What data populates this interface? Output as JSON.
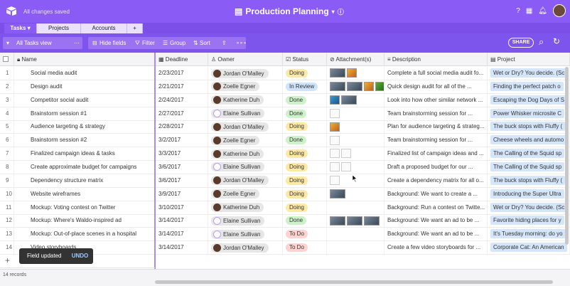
{
  "topbar": {
    "saved_text": "All changes saved",
    "base_title": "Production Planning",
    "icons": [
      "help-icon",
      "apps-icon",
      "bell-icon",
      "avatar"
    ]
  },
  "tabs": [
    {
      "label": "Tasks ▾",
      "active": true
    },
    {
      "label": "Projects",
      "active": false
    },
    {
      "label": "Accounts",
      "active": false
    },
    {
      "label": "+",
      "active": false
    }
  ],
  "toolbar": {
    "view_name": "All Tasks view",
    "hide_fields": "Hide fields",
    "filter": "Filter",
    "group": "Group",
    "sort": "Sort",
    "share": "SHARE"
  },
  "columns": [
    "Name",
    "Deadline",
    "Owner",
    "Status",
    "Attachment(s)",
    "Description",
    "Project"
  ],
  "rows": [
    {
      "num": "1",
      "name": "Social media audit",
      "deadline": "2/23/2017",
      "owner": "Jordan O'Malley",
      "av": "dark",
      "status": "Doing",
      "att": [
        "img",
        "img2"
      ],
      "desc": "Complete a full social media audit fo...",
      "proj": "Wet or Dry? You decide. (Sc"
    },
    {
      "num": "2",
      "name": "Design audit",
      "deadline": "2/21/2017",
      "owner": "Zoelle Egner",
      "av": "dark",
      "status": "In Review",
      "att": [
        "img",
        "img",
        "img2",
        "img4"
      ],
      "desc": "Quick design audit for all of the ...",
      "proj": "Finding the perfect patch o"
    },
    {
      "num": "3",
      "name": "Competitor social audit",
      "deadline": "2/24/2017",
      "owner": "Katherine Duh",
      "av": "dark",
      "status": "Done",
      "att": [
        "img3",
        "img"
      ],
      "desc": "Look into how other similar network ...",
      "proj": "Escaping the Dog Days of S"
    },
    {
      "num": "4",
      "name": "Brainstorm session #1",
      "deadline": "2/27/2017",
      "owner": "Elaine Sullivan",
      "av": "outline",
      "status": "Done",
      "att": [
        "doc"
      ],
      "desc": "Team brainstorming session for ...",
      "proj": "Power Whisker microsite  C"
    },
    {
      "num": "5",
      "name": "Audience targeting & strategy",
      "deadline": "2/28/2017",
      "owner": "Jordan O'Malley",
      "av": "dark",
      "status": "Doing",
      "att": [
        "img2"
      ],
      "desc": "Plan for audience targeting & strateg...",
      "proj": "The buck stops with Fluffy ("
    },
    {
      "num": "6",
      "name": "Brainstorm session #2",
      "deadline": "3/2/2017",
      "owner": "Zoelle Egner",
      "av": "dark",
      "status": "Done",
      "att": [
        "doc"
      ],
      "desc": "Team brainstorming session for ...",
      "proj": "Cheese wheels and automo"
    },
    {
      "num": "7",
      "name": "Finalized campaign ideas & tasks",
      "deadline": "3/3/2017",
      "owner": "Katherine Duh",
      "av": "dark",
      "status": "Doing",
      "att": [
        "doc",
        "doc"
      ],
      "desc": "Finalized list of campaign ideas and ...",
      "proj": "The Calling of the Squid sp"
    },
    {
      "num": "8",
      "name": "Create approximate budget for campaigns",
      "deadline": "3/6/2017",
      "owner": "Elaine Sullivan",
      "av": "outline",
      "status": "Doing",
      "att": [
        "doc",
        "doc"
      ],
      "desc": "Draft a proposed budget for our ...",
      "proj": "The Calling of the Squid sp"
    },
    {
      "num": "9",
      "name": "Dependency structure matrix",
      "deadline": "3/6/2017",
      "owner": "Jordan O'Malley",
      "av": "dark",
      "status": "Doing",
      "att": [
        "doc"
      ],
      "desc": "Create a dependency matrix for all o...",
      "proj": "The buck stops with Fluffy ("
    },
    {
      "num": "10",
      "name": "Website wireframes",
      "deadline": "3/9/2017",
      "owner": "Zoelle Egner",
      "av": "dark",
      "status": "Doing",
      "att": [
        "img"
      ],
      "desc": "Background: We want to create a ...",
      "proj": "Introducing the Super Ultra"
    },
    {
      "num": "11",
      "name": "Mockup: Voting contest on Twitter",
      "deadline": "3/10/2017",
      "owner": "Katherine Duh",
      "av": "dark",
      "status": "Doing",
      "att": [],
      "desc": "Background: Run a contest on Twitte...",
      "proj": "Wet or Dry? You decide. (Sc"
    },
    {
      "num": "12",
      "name": "Mockup: Where's Waldo-inspired ad",
      "deadline": "3/14/2017",
      "owner": "Elaine Sullivan",
      "av": "outline",
      "status": "Done",
      "att": [
        "img",
        "img",
        "img"
      ],
      "desc": "Background: We want an ad to be ...",
      "proj": "Favorite hiding places for y"
    },
    {
      "num": "13",
      "name": "Mockup: Out-of-place scenes in a hospital",
      "deadline": "3/14/2017",
      "owner": "Elaine Sullivan",
      "av": "outline",
      "status": "To Do",
      "att": [],
      "desc": "Background: We want an ad to be ...",
      "proj": "It's Tuesday morning: do yo"
    },
    {
      "num": "14",
      "name": "Video storyboards",
      "deadline": "3/14/2017",
      "owner": "Jordan O'Malley",
      "av": "dark",
      "status": "To Do",
      "att": [],
      "desc": "Create a few video storyboards for ...",
      "proj": "Corporate Cat: An American"
    }
  ],
  "status_colors": {
    "Doing": "#fde9a6",
    "In Review": "#cfe3fb",
    "Done": "#cdf2c9",
    "To Do": "#ffd3cf"
  },
  "toast": {
    "text": "Field updated",
    "undo": "UNDO"
  },
  "footer": {
    "records": "14 records",
    "add": "+"
  },
  "colors": {
    "accent": "#8a5cf5",
    "toolbar": "#7e55ec"
  }
}
